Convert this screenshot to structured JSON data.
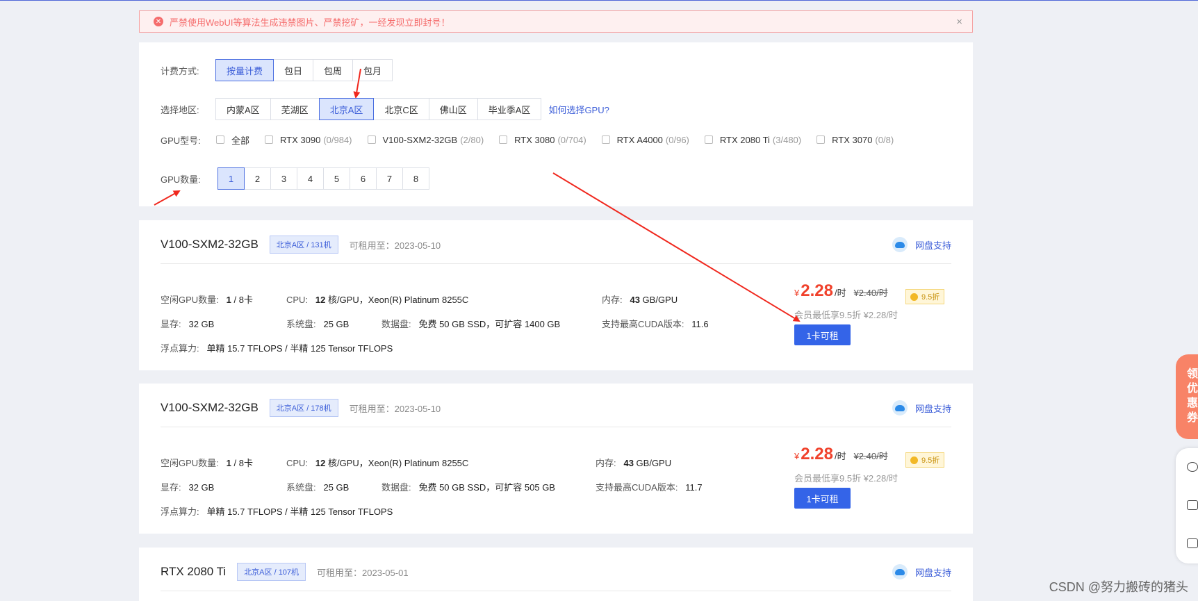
{
  "alert": {
    "text": "严禁使用WebUI等算法生成违禁图片、严禁挖矿，一经发现立即封号！",
    "close": "×"
  },
  "filter": {
    "billing": {
      "label": "计费方式:",
      "options": [
        "按量计费",
        "包日",
        "包周",
        "包月"
      ],
      "selected": "按量计费"
    },
    "region": {
      "label": "选择地区:",
      "options": [
        "内蒙A区",
        "芜湖区",
        "北京A区",
        "北京C区",
        "佛山区",
        "毕业季A区"
      ],
      "selected": "北京A区",
      "help": "如何选择GPU?"
    },
    "gpu_model": {
      "label": "GPU型号:",
      "items": [
        {
          "name": "全部",
          "count": ""
        },
        {
          "name": "RTX 3090",
          "count": "(0/984)"
        },
        {
          "name": "V100-SXM2-32GB",
          "count": "(2/80)"
        },
        {
          "name": "RTX 3080",
          "count": "(0/704)"
        },
        {
          "name": "RTX A4000",
          "count": "(0/96)"
        },
        {
          "name": "RTX 2080 Ti",
          "count": "(3/480)"
        },
        {
          "name": "RTX 3070",
          "count": "(0/8)"
        }
      ]
    },
    "gpu_count": {
      "label": "GPU数量:",
      "options": [
        "1",
        "2",
        "3",
        "4",
        "5",
        "6",
        "7",
        "8"
      ],
      "selected": "1"
    }
  },
  "cards": [
    {
      "gpu": "V100-SXM2-32GB",
      "tag": "北京A区 / 131机",
      "until": "可租用至：2023-05-10",
      "disk_support": "网盘支持",
      "idle_label": "空闲GPU数量:",
      "idle_value": "1",
      "idle_total": " / 8卡",
      "cpu_label": "CPU:",
      "cpu_cores": "12",
      "cpu_rest": " 核/GPU，Xeon(R) Platinum 8255C",
      "mem_label": "内存:",
      "mem_value": "43",
      "mem_unit": " GB/GPU",
      "vram_label": "显存:",
      "vram_value": "32 GB",
      "sysdisk_label": "系统盘:",
      "sysdisk_value": "25 GB",
      "datadisk_label": "数据盘:",
      "datadisk_value": "免费 50 GB SSD，可扩容 1400 GB",
      "cuda_label": "支持最高CUDA版本:",
      "cuda_value": "11.6",
      "flops_label": "浮点算力:",
      "flops_value": "单精 15.7 TFLOPS / 半精 125 Tensor TFLOPS",
      "yen": "¥",
      "price": "2.28",
      "unit": "/时",
      "old_price": "¥2.40/时",
      "discount": "9.5折",
      "member": "会员最低享9.5折 ¥2.28/时",
      "rent": "1卡可租"
    },
    {
      "gpu": "V100-SXM2-32GB",
      "tag": "北京A区 / 178机",
      "until": "可租用至：2023-05-10",
      "disk_support": "网盘支持",
      "idle_label": "空闲GPU数量:",
      "idle_value": "1",
      "idle_total": " / 8卡",
      "cpu_label": "CPU:",
      "cpu_cores": "12",
      "cpu_rest": " 核/GPU，Xeon(R) Platinum 8255C",
      "mem_label": "内存:",
      "mem_value": "43",
      "mem_unit": " GB/GPU",
      "vram_label": "显存:",
      "vram_value": "32 GB",
      "sysdisk_label": "系统盘:",
      "sysdisk_value": "25 GB",
      "datadisk_label": "数据盘:",
      "datadisk_value": "免费 50 GB SSD，可扩容 505 GB",
      "cuda_label": "支持最高CUDA版本:",
      "cuda_value": "11.7",
      "flops_label": "浮点算力:",
      "flops_value": "单精 15.7 TFLOPS / 半精 125 Tensor TFLOPS",
      "yen": "¥",
      "price": "2.28",
      "unit": "/时",
      "old_price": "¥2.40/时",
      "discount": "9.5折",
      "member": "会员最低享9.5折 ¥2.28/时",
      "rent": "1卡可租"
    },
    {
      "gpu": "RTX 2080 Ti",
      "tag": "北京A区 / 107机",
      "until": "可租用至：2023-05-01",
      "disk_support": "网盘支持"
    }
  ],
  "side": {
    "coupon": "领优惠券"
  },
  "watermark": "CSDN @努力搬砖的猪头",
  "colors": {
    "accent": "#3464e8",
    "price": "#f0422c",
    "annotation_arrow": "#f0281e"
  }
}
